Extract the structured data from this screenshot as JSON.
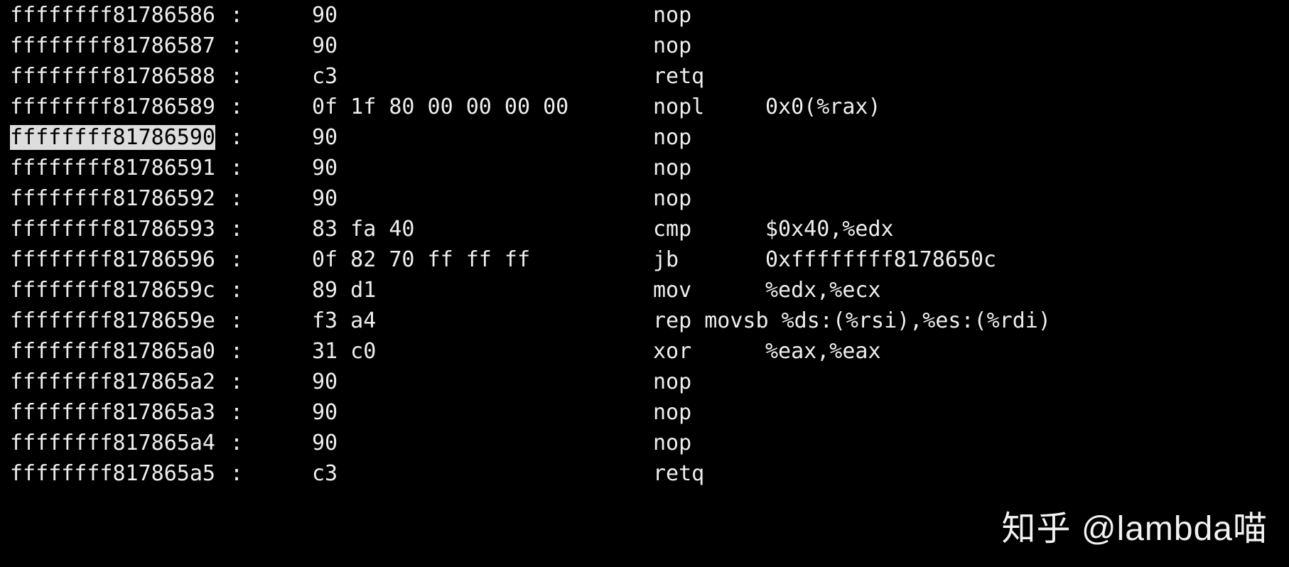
{
  "highlightIndex": 4,
  "rows": [
    {
      "addr": "ffffffff81786586",
      "bytes": "90",
      "mnem": "nop",
      "ops": ""
    },
    {
      "addr": "ffffffff81786587",
      "bytes": "90",
      "mnem": "nop",
      "ops": ""
    },
    {
      "addr": "ffffffff81786588",
      "bytes": "c3",
      "mnem": "retq",
      "ops": ""
    },
    {
      "addr": "ffffffff81786589",
      "bytes": "0f 1f 80 00 00 00 00",
      "mnem": "nopl",
      "ops": "0x0(%rax)"
    },
    {
      "addr": "ffffffff81786590",
      "bytes": "90",
      "mnem": "nop",
      "ops": ""
    },
    {
      "addr": "ffffffff81786591",
      "bytes": "90",
      "mnem": "nop",
      "ops": ""
    },
    {
      "addr": "ffffffff81786592",
      "bytes": "90",
      "mnem": "nop",
      "ops": ""
    },
    {
      "addr": "ffffffff81786593",
      "bytes": "83 fa 40",
      "mnem": "cmp",
      "ops": "$0x40,%edx"
    },
    {
      "addr": "ffffffff81786596",
      "bytes": "0f 82 70 ff ff ff",
      "mnem": "jb",
      "ops": "0xffffffff8178650c"
    },
    {
      "addr": "ffffffff8178659c",
      "bytes": "89 d1",
      "mnem": "mov",
      "ops": "%edx,%ecx"
    },
    {
      "addr": "ffffffff8178659e",
      "bytes": "f3 a4",
      "mnem": "rep movsb",
      "ops": "%ds:(%rsi),%es:(%rdi)"
    },
    {
      "addr": "ffffffff817865a0",
      "bytes": "31 c0",
      "mnem": "xor",
      "ops": "%eax,%eax"
    },
    {
      "addr": "ffffffff817865a2",
      "bytes": "90",
      "mnem": "nop",
      "ops": ""
    },
    {
      "addr": "ffffffff817865a3",
      "bytes": "90",
      "mnem": "nop",
      "ops": ""
    },
    {
      "addr": "ffffffff817865a4",
      "bytes": "90",
      "mnem": "nop",
      "ops": ""
    },
    {
      "addr": "ffffffff817865a5",
      "bytes": "c3",
      "mnem": "retq",
      "ops": ""
    }
  ],
  "watermark": "知乎 @lambda喵"
}
